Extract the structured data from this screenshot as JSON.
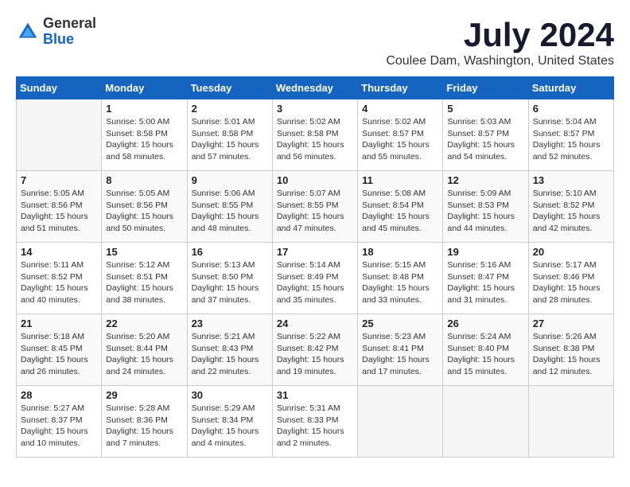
{
  "logo": {
    "general": "General",
    "blue": "Blue"
  },
  "title": "July 2024",
  "subtitle": "Coulee Dam, Washington, United States",
  "days_of_week": [
    "Sunday",
    "Monday",
    "Tuesday",
    "Wednesday",
    "Thursday",
    "Friday",
    "Saturday"
  ],
  "weeks": [
    [
      {
        "day": "",
        "sunrise": "",
        "sunset": "",
        "daylight": ""
      },
      {
        "day": "1",
        "sunrise": "Sunrise: 5:00 AM",
        "sunset": "Sunset: 8:58 PM",
        "daylight": "Daylight: 15 hours and 58 minutes."
      },
      {
        "day": "2",
        "sunrise": "Sunrise: 5:01 AM",
        "sunset": "Sunset: 8:58 PM",
        "daylight": "Daylight: 15 hours and 57 minutes."
      },
      {
        "day": "3",
        "sunrise": "Sunrise: 5:02 AM",
        "sunset": "Sunset: 8:58 PM",
        "daylight": "Daylight: 15 hours and 56 minutes."
      },
      {
        "day": "4",
        "sunrise": "Sunrise: 5:02 AM",
        "sunset": "Sunset: 8:57 PM",
        "daylight": "Daylight: 15 hours and 55 minutes."
      },
      {
        "day": "5",
        "sunrise": "Sunrise: 5:03 AM",
        "sunset": "Sunset: 8:57 PM",
        "daylight": "Daylight: 15 hours and 54 minutes."
      },
      {
        "day": "6",
        "sunrise": "Sunrise: 5:04 AM",
        "sunset": "Sunset: 8:57 PM",
        "daylight": "Daylight: 15 hours and 52 minutes."
      }
    ],
    [
      {
        "day": "7",
        "sunrise": "Sunrise: 5:05 AM",
        "sunset": "Sunset: 8:56 PM",
        "daylight": "Daylight: 15 hours and 51 minutes."
      },
      {
        "day": "8",
        "sunrise": "Sunrise: 5:05 AM",
        "sunset": "Sunset: 8:56 PM",
        "daylight": "Daylight: 15 hours and 50 minutes."
      },
      {
        "day": "9",
        "sunrise": "Sunrise: 5:06 AM",
        "sunset": "Sunset: 8:55 PM",
        "daylight": "Daylight: 15 hours and 48 minutes."
      },
      {
        "day": "10",
        "sunrise": "Sunrise: 5:07 AM",
        "sunset": "Sunset: 8:55 PM",
        "daylight": "Daylight: 15 hours and 47 minutes."
      },
      {
        "day": "11",
        "sunrise": "Sunrise: 5:08 AM",
        "sunset": "Sunset: 8:54 PM",
        "daylight": "Daylight: 15 hours and 45 minutes."
      },
      {
        "day": "12",
        "sunrise": "Sunrise: 5:09 AM",
        "sunset": "Sunset: 8:53 PM",
        "daylight": "Daylight: 15 hours and 44 minutes."
      },
      {
        "day": "13",
        "sunrise": "Sunrise: 5:10 AM",
        "sunset": "Sunset: 8:52 PM",
        "daylight": "Daylight: 15 hours and 42 minutes."
      }
    ],
    [
      {
        "day": "14",
        "sunrise": "Sunrise: 5:11 AM",
        "sunset": "Sunset: 8:52 PM",
        "daylight": "Daylight: 15 hours and 40 minutes."
      },
      {
        "day": "15",
        "sunrise": "Sunrise: 5:12 AM",
        "sunset": "Sunset: 8:51 PM",
        "daylight": "Daylight: 15 hours and 38 minutes."
      },
      {
        "day": "16",
        "sunrise": "Sunrise: 5:13 AM",
        "sunset": "Sunset: 8:50 PM",
        "daylight": "Daylight: 15 hours and 37 minutes."
      },
      {
        "day": "17",
        "sunrise": "Sunrise: 5:14 AM",
        "sunset": "Sunset: 8:49 PM",
        "daylight": "Daylight: 15 hours and 35 minutes."
      },
      {
        "day": "18",
        "sunrise": "Sunrise: 5:15 AM",
        "sunset": "Sunset: 8:48 PM",
        "daylight": "Daylight: 15 hours and 33 minutes."
      },
      {
        "day": "19",
        "sunrise": "Sunrise: 5:16 AM",
        "sunset": "Sunset: 8:47 PM",
        "daylight": "Daylight: 15 hours and 31 minutes."
      },
      {
        "day": "20",
        "sunrise": "Sunrise: 5:17 AM",
        "sunset": "Sunset: 8:46 PM",
        "daylight": "Daylight: 15 hours and 28 minutes."
      }
    ],
    [
      {
        "day": "21",
        "sunrise": "Sunrise: 5:18 AM",
        "sunset": "Sunset: 8:45 PM",
        "daylight": "Daylight: 15 hours and 26 minutes."
      },
      {
        "day": "22",
        "sunrise": "Sunrise: 5:20 AM",
        "sunset": "Sunset: 8:44 PM",
        "daylight": "Daylight: 15 hours and 24 minutes."
      },
      {
        "day": "23",
        "sunrise": "Sunrise: 5:21 AM",
        "sunset": "Sunset: 8:43 PM",
        "daylight": "Daylight: 15 hours and 22 minutes."
      },
      {
        "day": "24",
        "sunrise": "Sunrise: 5:22 AM",
        "sunset": "Sunset: 8:42 PM",
        "daylight": "Daylight: 15 hours and 19 minutes."
      },
      {
        "day": "25",
        "sunrise": "Sunrise: 5:23 AM",
        "sunset": "Sunset: 8:41 PM",
        "daylight": "Daylight: 15 hours and 17 minutes."
      },
      {
        "day": "26",
        "sunrise": "Sunrise: 5:24 AM",
        "sunset": "Sunset: 8:40 PM",
        "daylight": "Daylight: 15 hours and 15 minutes."
      },
      {
        "day": "27",
        "sunrise": "Sunrise: 5:26 AM",
        "sunset": "Sunset: 8:38 PM",
        "daylight": "Daylight: 15 hours and 12 minutes."
      }
    ],
    [
      {
        "day": "28",
        "sunrise": "Sunrise: 5:27 AM",
        "sunset": "Sunset: 8:37 PM",
        "daylight": "Daylight: 15 hours and 10 minutes."
      },
      {
        "day": "29",
        "sunrise": "Sunrise: 5:28 AM",
        "sunset": "Sunset: 8:36 PM",
        "daylight": "Daylight: 15 hours and 7 minutes."
      },
      {
        "day": "30",
        "sunrise": "Sunrise: 5:29 AM",
        "sunset": "Sunset: 8:34 PM",
        "daylight": "Daylight: 15 hours and 4 minutes."
      },
      {
        "day": "31",
        "sunrise": "Sunrise: 5:31 AM",
        "sunset": "Sunset: 8:33 PM",
        "daylight": "Daylight: 15 hours and 2 minutes."
      },
      {
        "day": "",
        "sunrise": "",
        "sunset": "",
        "daylight": ""
      },
      {
        "day": "",
        "sunrise": "",
        "sunset": "",
        "daylight": ""
      },
      {
        "day": "",
        "sunrise": "",
        "sunset": "",
        "daylight": ""
      }
    ]
  ]
}
